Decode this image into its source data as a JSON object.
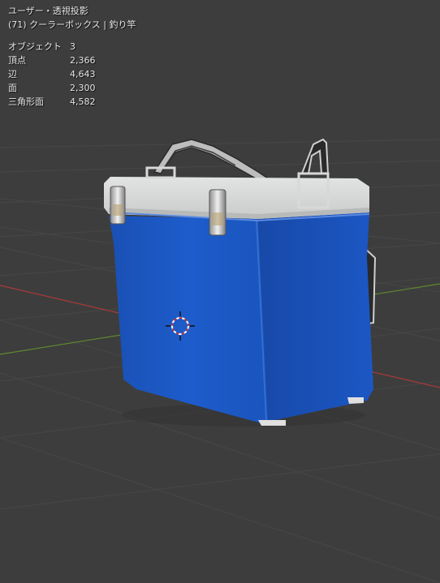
{
  "viewport": {
    "view_label": "ユーザー・透視投影",
    "frame_and_object": "(71) クーラーボックス | 釣り竿"
  },
  "stats": [
    {
      "label": "オブジェクト",
      "value": "3"
    },
    {
      "label": "頂点",
      "value": "2,366"
    },
    {
      "label": "辺",
      "value": "4,643"
    },
    {
      "label": "面",
      "value": "2,300"
    },
    {
      "label": "三角形面",
      "value": "4,582"
    }
  ],
  "colors": {
    "background": "#3d3d3d",
    "cooler_body": "#1b58c2",
    "cooler_lid": "#d4d6d6",
    "x_axis": "#a83a3a",
    "y_axis": "#5e8a2e"
  },
  "icons": {
    "cursor": "3d-cursor-icon"
  }
}
